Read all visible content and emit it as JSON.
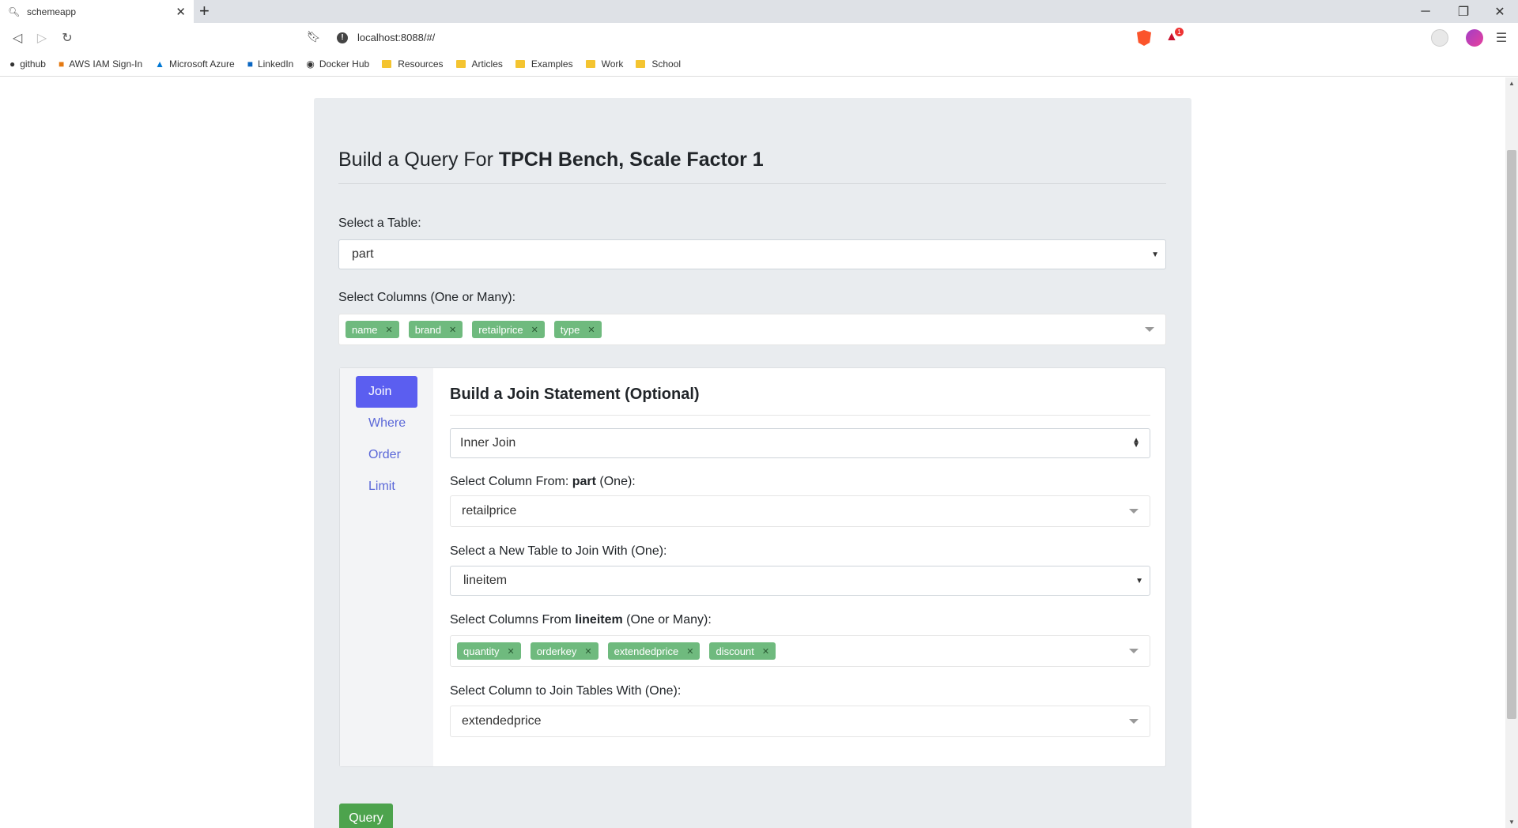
{
  "browser": {
    "tab_title": "schemeapp",
    "url": "localhost:8088/#/",
    "bookmarks": [
      "github",
      "AWS IAM Sign-In",
      "Microsoft Azure",
      "LinkedIn",
      "Docker Hub",
      "Resources",
      "Articles",
      "Examples",
      "Work",
      "School"
    ],
    "rewards_count": "1"
  },
  "page": {
    "heading_prefix": "Build a Query For ",
    "heading_bold": "TPCH Bench, Scale Factor 1",
    "table_label": "Select a Table:",
    "table_value": "part",
    "columns_label": "Select Columns (One or Many):",
    "columns": [
      "name",
      "brand",
      "retailprice",
      "type"
    ]
  },
  "join_panel": {
    "nav": [
      "Join",
      "Where",
      "Order",
      "Limit"
    ],
    "title": "Build a Join Statement (Optional)",
    "join_type": "Inner Join",
    "from_label_prefix": "Select Column From: ",
    "from_label_table": "part",
    "from_label_suffix": " (One):",
    "from_value": "retailprice",
    "new_table_label": "Select a New Table to Join With (One):",
    "new_table_value": "lineitem",
    "cols_label_prefix": "Select Columns From ",
    "cols_label_table": "lineitem",
    "cols_label_suffix": " (One or Many):",
    "cols": [
      "quantity",
      "orderkey",
      "extendedprice",
      "discount"
    ],
    "join_col_label": "Select Column to Join Tables With (One):",
    "join_col_value": "extendedprice"
  },
  "query_button": "Query",
  "colors": {
    "tag": "#6fba7e",
    "active_nav": "#5b5ef0",
    "query_button": "#4da34d"
  }
}
